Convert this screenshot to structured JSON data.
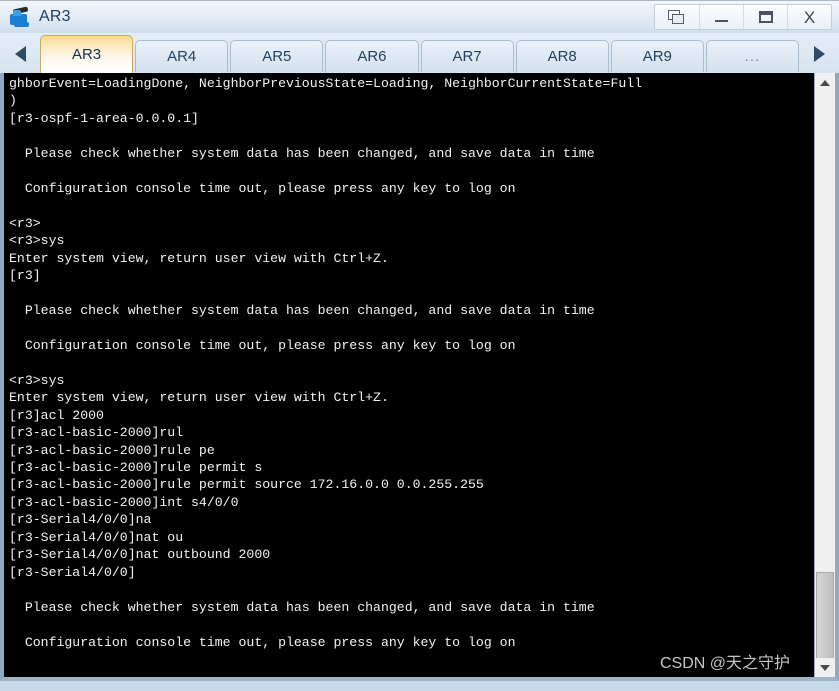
{
  "window": {
    "title": "AR3",
    "icon": "router-icon",
    "buttons": [
      {
        "name": "restore-window-button",
        "icon": "restore-icon",
        "label": ""
      },
      {
        "name": "minimize-window-button",
        "icon": "minimize-icon",
        "label": ""
      },
      {
        "name": "maximize-window-button",
        "icon": "maximize-icon",
        "label": ""
      },
      {
        "name": "close-window-button",
        "icon": "close-icon",
        "label": "X"
      }
    ]
  },
  "tabbar": {
    "scroll_left_icon": "triangle-left-icon",
    "scroll_right_icon": "triangle-right-icon",
    "active_tab": "AR3",
    "tabs": [
      {
        "label": "AR3",
        "active": true
      },
      {
        "label": "AR4",
        "active": false
      },
      {
        "label": "AR5",
        "active": false
      },
      {
        "label": "AR6",
        "active": false
      },
      {
        "label": "AR7",
        "active": false
      },
      {
        "label": "AR8",
        "active": false
      },
      {
        "label": "AR9",
        "active": false
      },
      {
        "label": "...",
        "active": false
      }
    ]
  },
  "console": {
    "text": "ghborEvent=LoadingDone, NeighborPreviousState=Loading, NeighborCurrentState=Full\n)\n[r3-ospf-1-area-0.0.0.1]\n\n  Please check whether system data has been changed, and save data in time\n\n  Configuration console time out, please press any key to log on\n\n<r3>\n<r3>sys\nEnter system view, return user view with Ctrl+Z.\n[r3]\n\n  Please check whether system data has been changed, and save data in time\n\n  Configuration console time out, please press any key to log on\n\n<r3>sys\nEnter system view, return user view with Ctrl+Z.\n[r3]acl 2000\n[r3-acl-basic-2000]rul\n[r3-acl-basic-2000]rule pe\n[r3-acl-basic-2000]rule permit s\n[r3-acl-basic-2000]rule permit source 172.16.0.0 0.0.255.255\n[r3-acl-basic-2000]int s4/0/0\n[r3-Serial4/0/0]na\n[r3-Serial4/0/0]nat ou\n[r3-Serial4/0/0]nat outbound 2000\n[r3-Serial4/0/0]\n\n  Please check whether system data has been changed, and save data in time\n\n  Configuration console time out, please press any key to log on\n",
    "foreground_color": "#f2f2f2",
    "background_color": "#000000"
  },
  "scrollbar": {
    "up_icon": "chevron-up-icon",
    "down_icon": "chevron-down-icon",
    "orientation": "vertical"
  },
  "watermark": {
    "text": "CSDN @天之守护"
  }
}
